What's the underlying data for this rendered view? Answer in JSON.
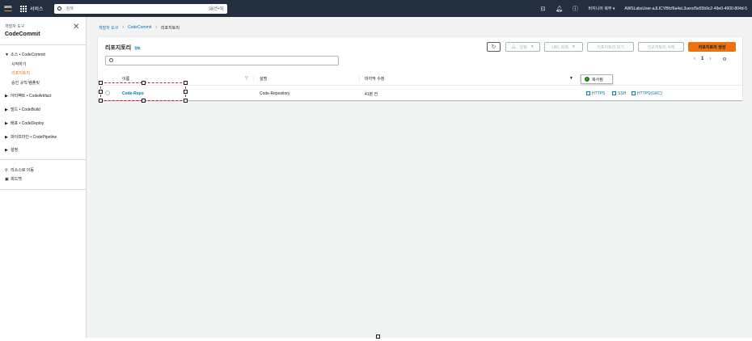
{
  "topnav": {
    "logo": "aws",
    "services_label": "서비스",
    "search_placeholder": "검색",
    "search_shortcut": "[옵션+S]",
    "region_label": "버지니아 북부 ▾",
    "account_label": "AWSLabsUser-aJLICYBfcf6a4sL3uerz/5e55b9c2-49e0-4900-804d-5"
  },
  "sidebar": {
    "parent_label": "개발자 도구",
    "title": "CodeCommit",
    "items": [
      {
        "label": "소스 • CodeCommit",
        "expanded": true
      },
      {
        "label": "시작하기"
      },
      {
        "label": "리포지토리",
        "active": true
      },
      {
        "label": "승인 규칙 템플릿"
      },
      {
        "label": "아티팩트 • CodeArtifact"
      },
      {
        "label": "빌드 • CodeBuild"
      },
      {
        "label": "배포 • CodeDeploy"
      },
      {
        "label": "파이프라인 • CodePipeline"
      },
      {
        "label": "설정"
      },
      {
        "label": "리소스로 이동"
      },
      {
        "label": "피드백"
      }
    ]
  },
  "breadcrumb": {
    "items": [
      "개발자 도구",
      "CodeCommit",
      "리포지토리"
    ]
  },
  "panel": {
    "title": "리포지토리",
    "info_link": "정보",
    "buttons": {
      "notify": "알림",
      "clone_url": "URL 복제",
      "view": "리포지토리 보기",
      "delete": "리포지토리 삭제",
      "create": "리포지토리 생성"
    },
    "filter_placeholder": "",
    "page_number": "1"
  },
  "table": {
    "columns": [
      "이름",
      "설명",
      "마지막 수정",
      "URL 복제"
    ],
    "rows": [
      {
        "name": "Code-Repo",
        "description": "Code-Repository",
        "last_modified": "41분 전",
        "clone_https": "HTTPS",
        "clone_ssh": "SSH",
        "clone_grc": "HTTPS(GRC)"
      }
    ]
  },
  "popover": {
    "text": "복사됨"
  },
  "colors": {
    "nav_bg": "#232f3e",
    "accent_orange": "#ec7211",
    "link_blue": "#0073bb",
    "success_green": "#1d8102",
    "selection_red": "#c7223e"
  }
}
